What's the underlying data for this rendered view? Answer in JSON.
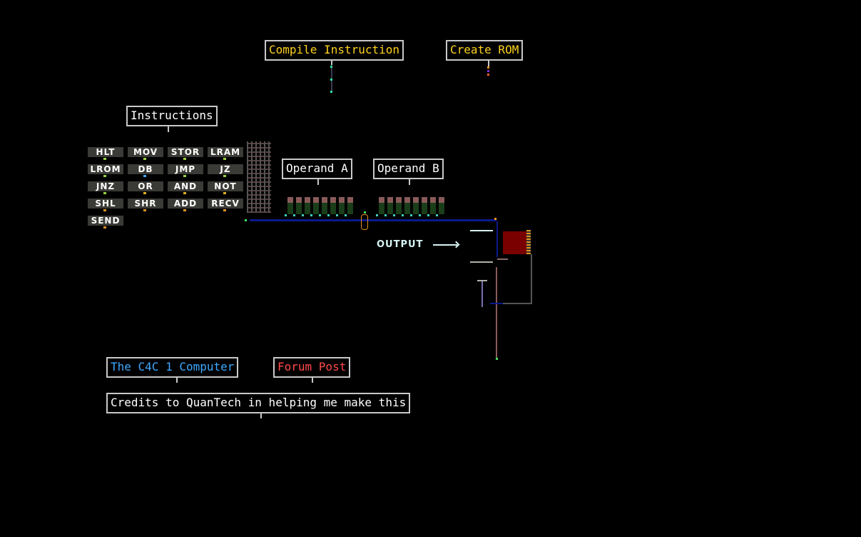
{
  "labels": {
    "compile": "Compile Instruction",
    "create_rom": "Create ROM",
    "instructions": "Instructions",
    "operand_a": "Operand A",
    "operand_b": "Operand B",
    "output": "OUTPUT",
    "computer_name": "The C4C 1 Computer",
    "forum_post": "Forum Post",
    "credits": "Credits to QuanTech in helping me make this"
  },
  "colors": {
    "compile_text": "#ffd21e",
    "rom_text": "#ffd21e",
    "computer_text": "#3ea8ff",
    "forum_text": "#ff4a4a",
    "default_text": "#ffffff",
    "box_border": "#c8c8c8",
    "button_bg": "#3a3a36",
    "bus_wire": "#0a1a8c",
    "display": "#7a0000"
  },
  "instructions": [
    {
      "label": "HLT",
      "pin": "#9ad23c"
    },
    {
      "label": "MOV",
      "pin": "#9ad23c"
    },
    {
      "label": "STOR",
      "pin": "#9ad23c"
    },
    {
      "label": "LRAM",
      "pin": "#9ad23c"
    },
    {
      "label": "LROM",
      "pin": "#9ad23c"
    },
    {
      "label": "DB",
      "pin": "#3ea8ff"
    },
    {
      "label": "JMP",
      "pin": "#9ad23c"
    },
    {
      "label": "JZ",
      "pin": "#9ad23c"
    },
    {
      "label": "JNZ",
      "pin": "#9ad23c"
    },
    {
      "label": "OR",
      "pin": "#e0b020"
    },
    {
      "label": "AND",
      "pin": "#e0b020"
    },
    {
      "label": "NOT",
      "pin": "#e0b020"
    },
    {
      "label": "SHL",
      "pin": "#e09020"
    },
    {
      "label": "SHR",
      "pin": "#e09020"
    },
    {
      "label": "ADD",
      "pin": "#e09020"
    },
    {
      "label": "RECV",
      "pin": "#e09020"
    },
    {
      "label": "SEND",
      "pin": "#e09020"
    }
  ],
  "operand_a_bits": 8,
  "operand_b_bits": 8
}
